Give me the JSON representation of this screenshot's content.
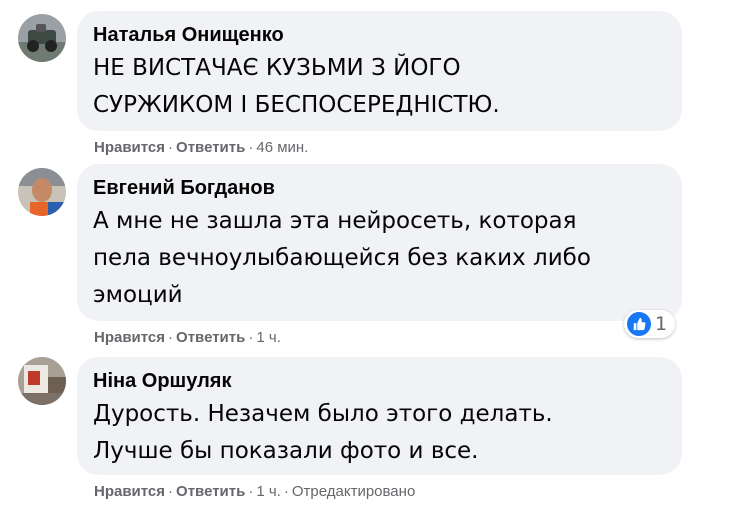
{
  "comments": [
    {
      "author": "Наталья Онищенко",
      "text": "НЕ ВИСТАЧАЄ КУЗЬМИ З ЙОГО\nСУРЖИКОМ І БЕСПОСЕРЕДНІСТЮ.",
      "like_label": "Нравится",
      "reply_label": "Ответить",
      "time": "46 мин.",
      "edited": ""
    },
    {
      "author": "Евгений Богданов",
      "text": "А мне не зашла эта нейросеть, которая\nпела вечноулыбающейся без каких либо\nэмоций",
      "like_label": "Нравится",
      "reply_label": "Ответить",
      "time": "1 ч.",
      "edited": "",
      "reactions": {
        "icon": "like-icon",
        "count": "1"
      }
    },
    {
      "author": "Ніна Оршуляк",
      "text": "Дурость. Незачем было этого делать.\nЛучше бы показали фото и все.",
      "like_label": "Нравится",
      "reply_label": "Ответить",
      "time": "1 ч.",
      "edited": "Отредактировано"
    }
  ],
  "colors": {
    "bubble": "#f0f2f5",
    "meta_text": "#65676b",
    "text": "#050505",
    "like_blue": "#1877f2"
  },
  "separator": "·"
}
